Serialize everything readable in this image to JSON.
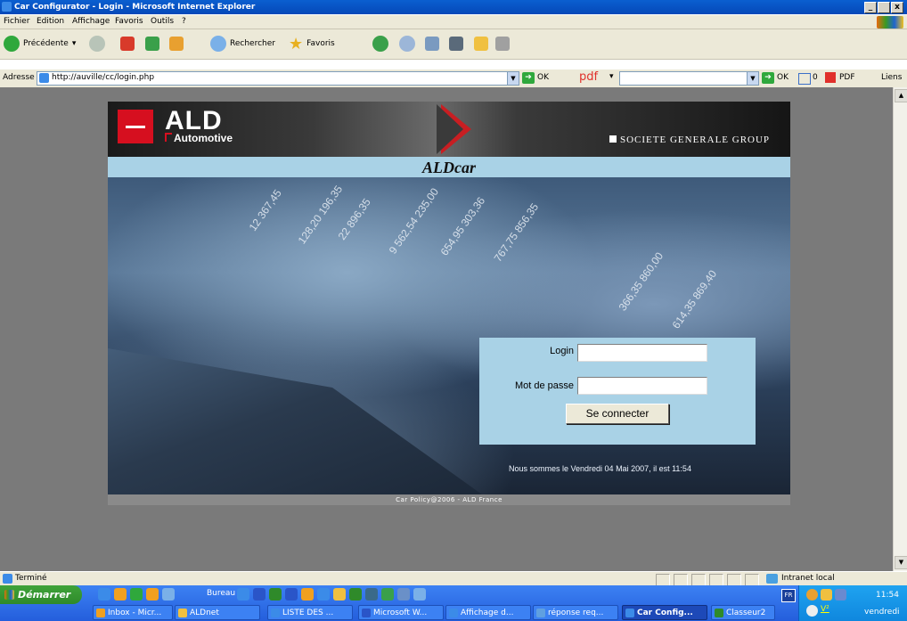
{
  "window": {
    "title": "Car Configurator - Login - Microsoft Internet Explorer",
    "min": "_",
    "max": " ",
    "close": "x"
  },
  "menu": [
    "Fichier",
    "Edition",
    "Affichage",
    "Favoris",
    "Outils",
    "?"
  ],
  "toolbar": {
    "back_label": "Précédente",
    "search_label": "Rechercher",
    "favorites_label": "Favoris"
  },
  "address": {
    "label": "Adresse",
    "url": "http://auville/cc/login.php",
    "go_label": "OK",
    "pdf_label": "pdf",
    "go2_label": "OK",
    "counter": "0",
    "pdf2_label": "PDF",
    "links_label": "Liens"
  },
  "banner": {
    "brand": "ALD",
    "sub": "Automotive",
    "group": "SOCIETE GENERALE GROUP"
  },
  "page": {
    "title": "ALDcar",
    "login_label": "Login",
    "login_value": "",
    "password_label": "Mot de passe",
    "password_value": "",
    "submit_label": "Se connecter",
    "date_text": "Nous sommes le Vendredi 04 Mai 2007, il est 11:54",
    "footer": "Car Policy@2006 - ALD France"
  },
  "status": {
    "text": "Terminé",
    "zone": "Intranet local"
  },
  "taskbar": {
    "start_label": "Démarrer",
    "bureau_label": "Bureau",
    "items": [
      {
        "label": "Inbox - Micr...",
        "color": "#f0a020"
      },
      {
        "label": "ALDnet",
        "color": "#f0c040"
      },
      {
        "label": "LISTE DES ...",
        "color": "#3b8be8"
      },
      {
        "label": "Microsoft W...",
        "color": "#2a55c8"
      },
      {
        "label": "Affichage d...",
        "color": "#3b8be8"
      },
      {
        "label": "réponse req...",
        "color": "#60a0e0"
      },
      {
        "label": "Car Config...",
        "color": "#3b8be8"
      },
      {
        "label": "Classeur2",
        "color": "#2f8a2a"
      }
    ],
    "lang": "FR",
    "clock": "11:54",
    "day": "vendredi"
  }
}
